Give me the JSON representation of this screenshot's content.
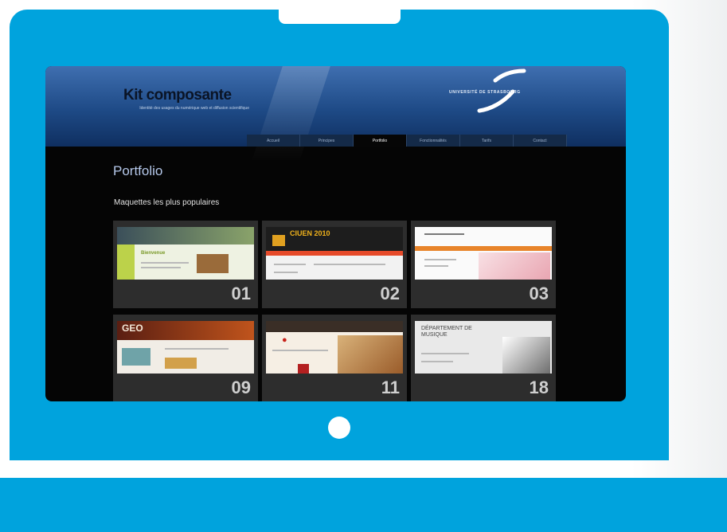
{
  "site": {
    "title": "Kit composante",
    "tagline": "Identité des usages du numérique web et diffusion scientifique",
    "university": "UNIVERSITÉ DE STRASBOURG"
  },
  "nav": {
    "items": [
      {
        "label": "Accueil",
        "active": false
      },
      {
        "label": "Principes",
        "active": false
      },
      {
        "label": "Portfolio",
        "active": true
      },
      {
        "label": "Fonctionnalités",
        "active": false
      },
      {
        "label": "Tarifs",
        "active": false
      },
      {
        "label": "Contact",
        "active": false
      }
    ]
  },
  "main": {
    "title": "Portfolio",
    "section_title": "Maquettes les plus populaires",
    "tiles": [
      {
        "number": "01",
        "thumb_title": "Bienvenue"
      },
      {
        "number": "02",
        "thumb_title": "CIUEN 2010"
      },
      {
        "number": "03",
        "thumb_title": ""
      },
      {
        "number": "09",
        "thumb_title": "GEO"
      },
      {
        "number": "11",
        "thumb_title": ""
      },
      {
        "number": "18",
        "thumb_title": "DÉPARTEMENT DE MUSIQUE"
      }
    ]
  },
  "colors": {
    "frame": "#00a3dd",
    "header_top": "#3f6fb0",
    "header_bottom": "#0f2f60",
    "screen_bg": "#050505",
    "tile_bg": "#2d2d2d",
    "title": "#b5c8ea"
  }
}
